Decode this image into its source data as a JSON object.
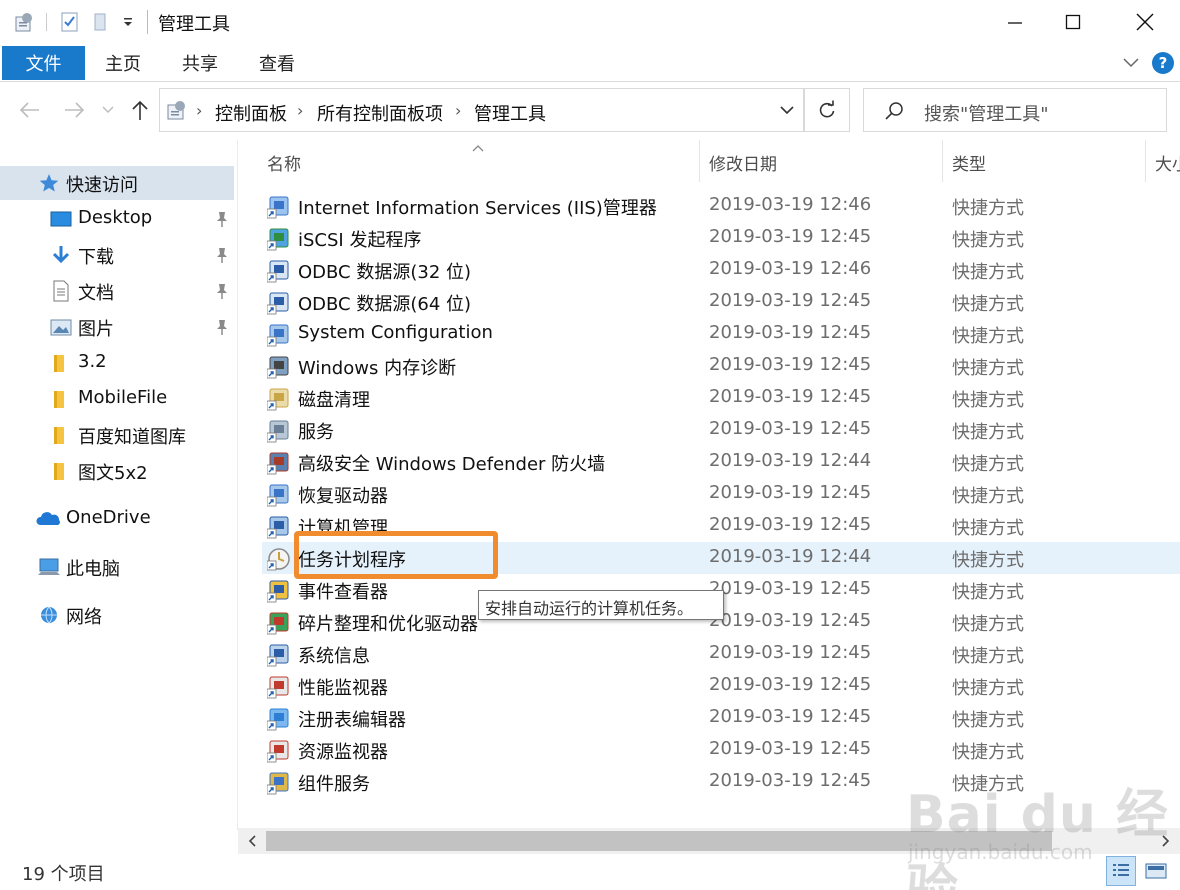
{
  "window": {
    "title": "管理工具"
  },
  "ribbon": {
    "tabs": [
      "文件",
      "主页",
      "共享",
      "查看"
    ],
    "help": "?"
  },
  "address": {
    "crumbs": [
      "控制面板",
      "所有控制面板项",
      "管理工具"
    ],
    "search_placeholder": "搜索\"管理工具\""
  },
  "sidebar": {
    "quick_access": "快速访问",
    "items": [
      {
        "label": "Desktop",
        "icon": "desktop-icon",
        "pinned": true
      },
      {
        "label": "下载",
        "icon": "download-icon",
        "pinned": true
      },
      {
        "label": "文档",
        "icon": "documents-icon",
        "pinned": true
      },
      {
        "label": "图片",
        "icon": "pictures-icon",
        "pinned": true
      },
      {
        "label": "3.2",
        "icon": "folder-icon",
        "pinned": false
      },
      {
        "label": "MobileFile",
        "icon": "folder-icon",
        "pinned": false
      },
      {
        "label": "百度知道图库",
        "icon": "folder-icon",
        "pinned": false
      },
      {
        "label": "图文5x2",
        "icon": "folder-icon",
        "pinned": false
      }
    ],
    "onedrive": "OneDrive",
    "this_pc": "此电脑",
    "network": "网络"
  },
  "columns": {
    "name": "名称",
    "date": "修改日期",
    "type": "类型",
    "size": "大小"
  },
  "files": [
    {
      "name": "Internet Information Services (IIS)管理器",
      "date": "2019-03-19 12:46",
      "type": "快捷方式",
      "icon": "iis-icon"
    },
    {
      "name": "iSCSI 发起程序",
      "date": "2019-03-19 12:45",
      "type": "快捷方式",
      "icon": "iscsi-icon"
    },
    {
      "name": "ODBC 数据源(32 位)",
      "date": "2019-03-19 12:46",
      "type": "快捷方式",
      "icon": "odbc-icon"
    },
    {
      "name": "ODBC 数据源(64 位)",
      "date": "2019-03-19 12:45",
      "type": "快捷方式",
      "icon": "odbc-icon"
    },
    {
      "name": "System Configuration",
      "date": "2019-03-19 12:45",
      "type": "快捷方式",
      "icon": "msconfig-icon"
    },
    {
      "name": "Windows 内存诊断",
      "date": "2019-03-19 12:45",
      "type": "快捷方式",
      "icon": "memory-diagnostic-icon"
    },
    {
      "name": "磁盘清理",
      "date": "2019-03-19 12:45",
      "type": "快捷方式",
      "icon": "disk-cleanup-icon"
    },
    {
      "name": "服务",
      "date": "2019-03-19 12:45",
      "type": "快捷方式",
      "icon": "services-icon"
    },
    {
      "name": "高级安全 Windows Defender 防火墙",
      "date": "2019-03-19 12:44",
      "type": "快捷方式",
      "icon": "firewall-icon"
    },
    {
      "name": "恢复驱动器",
      "date": "2019-03-19 12:45",
      "type": "快捷方式",
      "icon": "recovery-drive-icon"
    },
    {
      "name": "计算机管理",
      "date": "2019-03-19 12:45",
      "type": "快捷方式",
      "icon": "computer-management-icon"
    },
    {
      "name": "任务计划程序",
      "date": "2019-03-19 12:44",
      "type": "快捷方式",
      "icon": "task-scheduler-icon"
    },
    {
      "name": "事件查看器",
      "date": "2019-03-19 12:45",
      "type": "快捷方式",
      "icon": "event-viewer-icon"
    },
    {
      "name": "碎片整理和优化驱动器",
      "date": "2019-03-19 12:45",
      "type": "快捷方式",
      "icon": "defrag-icon"
    },
    {
      "name": "系统信息",
      "date": "2019-03-19 12:45",
      "type": "快捷方式",
      "icon": "system-info-icon"
    },
    {
      "name": "性能监视器",
      "date": "2019-03-19 12:45",
      "type": "快捷方式",
      "icon": "performance-monitor-icon"
    },
    {
      "name": "注册表编辑器",
      "date": "2019-03-19 12:45",
      "type": "快捷方式",
      "icon": "regedit-icon"
    },
    {
      "name": "资源监视器",
      "date": "2019-03-19 12:45",
      "type": "快捷方式",
      "icon": "resource-monitor-icon"
    },
    {
      "name": "组件服务",
      "date": "2019-03-19 12:45",
      "type": "快捷方式",
      "icon": "component-services-icon"
    }
  ],
  "hovered_index": 11,
  "tooltip": "安排自动运行的计算机任务。",
  "status": {
    "count": "19 个项目"
  },
  "watermark": {
    "brand": "Bai du 经验",
    "url": "jingyan.baidu.com"
  },
  "colors": {
    "accent": "#1979ca",
    "highlight": "#f08c2e",
    "hover_row": "#e5f1fb",
    "selected_nav": "#d9e3ee"
  }
}
